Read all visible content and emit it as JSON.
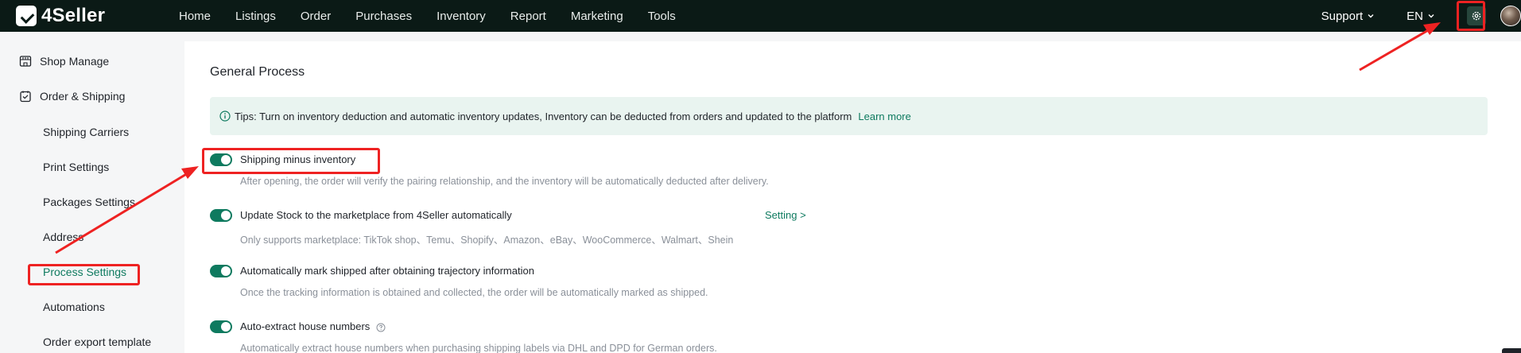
{
  "brand": {
    "name": "4Seller"
  },
  "nav": {
    "items": [
      "Home",
      "Listings",
      "Order",
      "Purchases",
      "Inventory",
      "Report",
      "Marketing",
      "Tools"
    ],
    "support_label": "Support",
    "lang_label": "EN"
  },
  "sidebar": {
    "groups": [
      {
        "label": "Shop Manage",
        "icon": "shop-icon"
      },
      {
        "label": "Order & Shipping",
        "icon": "order-icon"
      }
    ],
    "items": [
      {
        "label": "Shipping Carriers"
      },
      {
        "label": "Print Settings"
      },
      {
        "label": "Packages Settings"
      },
      {
        "label": "Address"
      },
      {
        "label": "Process Settings",
        "active": true
      },
      {
        "label": "Automations"
      },
      {
        "label": "Order export template"
      }
    ]
  },
  "main": {
    "title": "General Process",
    "tips": {
      "text": "Tips: Turn on inventory deduction and automatic inventory updates, Inventory can be deducted from orders and updated to the platform",
      "link": "Learn more"
    },
    "options": [
      {
        "label": "Shipping minus inventory",
        "enabled": true,
        "desc": "After opening, the order will verify the pairing relationship, and the inventory will be automatically deducted after delivery."
      },
      {
        "label": "Update Stock to the marketplace from 4Seller automatically",
        "enabled": true,
        "link": "Setting >",
        "desc": "Only supports marketplace: TikTok shop、Temu、Shopify、Amazon、eBay、WooCommerce、Walmart、Shein"
      },
      {
        "label": "Automatically mark shipped after obtaining trajectory information",
        "enabled": true,
        "desc": "Once the tracking information is obtained and collected, the order will be automatically marked as shipped."
      },
      {
        "label": "Auto-extract house numbers",
        "enabled": true,
        "desc": "Automatically extract house numbers when purchasing shipping labels via DHL and DPD for German orders."
      }
    ]
  },
  "colors": {
    "accent": "#0e7a5f",
    "topbar": "#0b1a16",
    "annotation": "#ee2222",
    "tips_bg": "#e9f4f0"
  }
}
